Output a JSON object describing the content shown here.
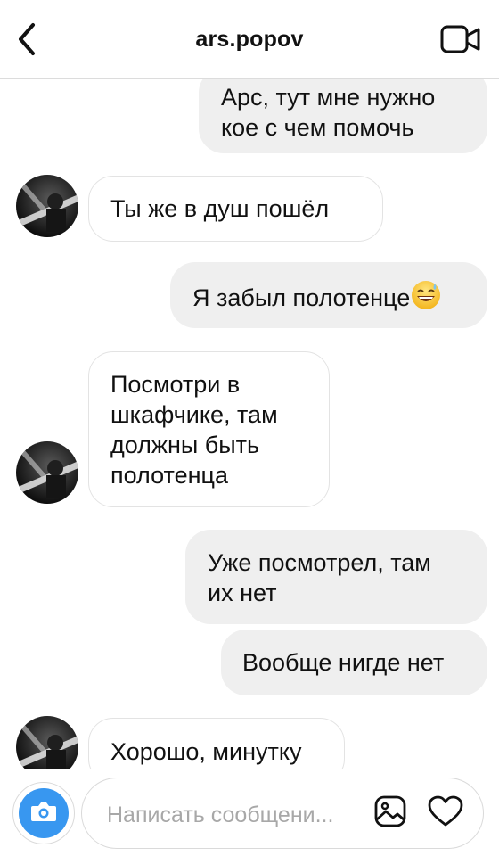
{
  "header": {
    "title": "ars.popov"
  },
  "messages": [
    {
      "direction": "outgoing",
      "lines": [
        "Арс, тут мне нужно",
        "кое с чем помочь"
      ]
    },
    {
      "direction": "incoming",
      "lines": [
        "Ты же в душ пошёл"
      ]
    },
    {
      "direction": "outgoing",
      "lines": [
        "Я забыл полотенце"
      ],
      "emoji": "grinning-face-with-sweat"
    },
    {
      "direction": "incoming",
      "lines": [
        "Посмотри в",
        "шкафчике, там",
        "должны быть",
        "полотенца"
      ]
    },
    {
      "direction": "outgoing",
      "lines": [
        "Уже посмотрел, там",
        "их нет"
      ]
    },
    {
      "direction": "outgoing",
      "lines": [
        "Вообще нигде нет"
      ]
    },
    {
      "direction": "incoming",
      "lines": [
        "Хорошо, минутку"
      ]
    }
  ],
  "composer": {
    "placeholder": "Написать сообщени..."
  },
  "icons": {
    "back": "chevron-left-icon",
    "video": "video-camera-icon",
    "camera": "camera-icon",
    "gallery": "image-icon",
    "like": "heart-icon"
  },
  "colors": {
    "outgoing_bubble": "#efefef",
    "camera_button": "#3897f0"
  }
}
